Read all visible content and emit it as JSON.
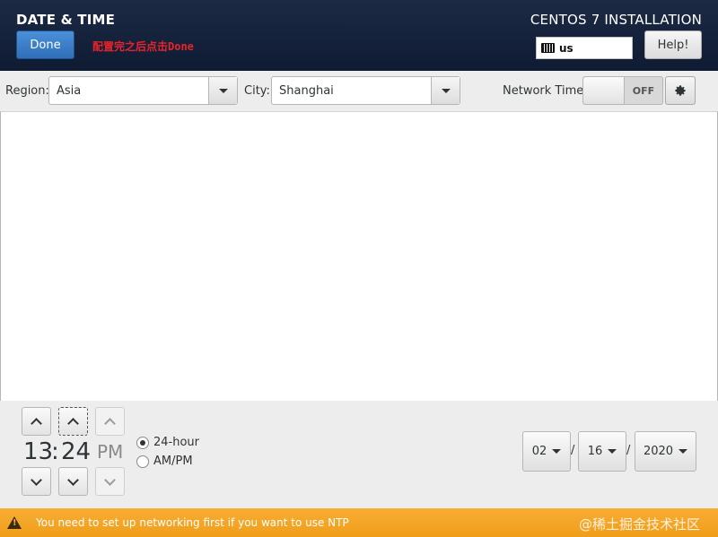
{
  "header": {
    "title": "DATE & TIME",
    "done_label": "Done",
    "annotation": "配置完之后点击Done",
    "installer_title": "CENTOS 7 INSTALLATION",
    "keyboard_layout": "us",
    "help_label": "Help!"
  },
  "toolbar": {
    "region_label": "Region:",
    "region_value": "Asia",
    "city_label": "City:",
    "city_value": "Shanghai",
    "network_time_label": "Network Time",
    "network_time_state": "OFF"
  },
  "time": {
    "hours": "13",
    "separator": ":",
    "minutes": "24",
    "ampm": "PM",
    "format_24": "24-hour",
    "format_ampm": "AM/PM",
    "selected_format": "24-hour"
  },
  "date": {
    "month": "02",
    "day": "16",
    "year": "2020",
    "separator": "/"
  },
  "status": {
    "warning": "You need to set up networking first if you want to use NTP",
    "watermark": "@稀土掘金技术社区"
  },
  "colors": {
    "header_bg": "#132038",
    "done_button": "#3a80cc",
    "warning_bar": "#f4a42a",
    "annotation_text": "#e8232a"
  },
  "icons": {
    "keyboard": "keyboard-icon",
    "gear": "gear-icon",
    "warning": "warning-icon",
    "dropdown": "chevron-down-icon",
    "up": "chevron-up-icon",
    "down": "chevron-down-icon"
  }
}
